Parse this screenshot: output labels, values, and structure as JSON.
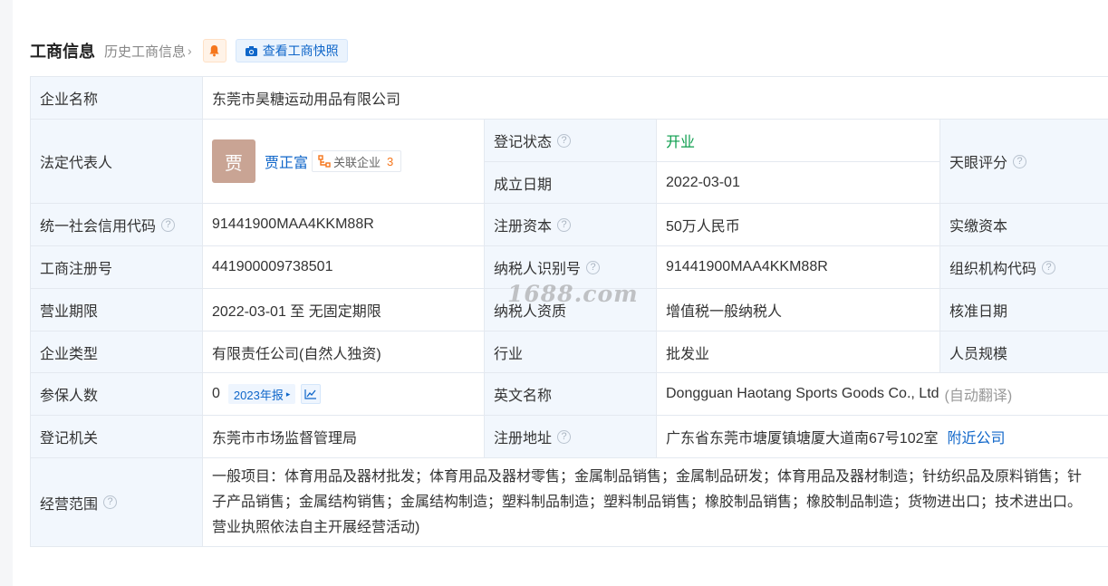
{
  "header": {
    "title": "工商信息",
    "history_link": "历史工商信息",
    "snapshot_label": "查看工商快照"
  },
  "rows": {
    "company_name": {
      "label": "企业名称",
      "value": "东莞市昊糖运动用品有限公司"
    },
    "legal_rep": {
      "label": "法定代表人",
      "avatar_char": "贾",
      "name": "贾正富",
      "related_label": "关联企业",
      "related_count": "3"
    },
    "reg_status": {
      "label": "登记状态",
      "value": "开业"
    },
    "founded": {
      "label": "成立日期",
      "value": "2022-03-01"
    },
    "tianyan_score": {
      "label": "天眼评分"
    },
    "credit_code": {
      "label": "统一社会信用代码",
      "value": "91441900MAA4KKM88R"
    },
    "reg_capital": {
      "label": "注册资本",
      "value": "50万人民币"
    },
    "paid_capital": {
      "label": "实缴资本"
    },
    "reg_number": {
      "label": "工商注册号",
      "value": "441900009738501"
    },
    "taxpayer_id": {
      "label": "纳税人识别号",
      "value": "91441900MAA4KKM88R"
    },
    "org_code": {
      "label": "组织机构代码"
    },
    "term": {
      "label": "营业期限",
      "value": "2022-03-01 至 无固定期限"
    },
    "taxpayer_qual": {
      "label": "纳税人资质",
      "value": "增值税一般纳税人"
    },
    "approval_date": {
      "label": "核准日期"
    },
    "company_type": {
      "label": "企业类型",
      "value": "有限责任公司(自然人独资)"
    },
    "industry": {
      "label": "行业",
      "value": "批发业"
    },
    "staff_size": {
      "label": "人员规模"
    },
    "insured": {
      "label": "参保人数",
      "value": "0",
      "report": "2023年报"
    },
    "english_name": {
      "label": "英文名称",
      "value": "Dongguan Haotang Sports Goods Co., Ltd",
      "translate": "(自动翻译)"
    },
    "reg_authority": {
      "label": "登记机关",
      "value": "东莞市市场监督管理局"
    },
    "reg_address": {
      "label": "注册地址",
      "value": "广东省东莞市塘厦镇塘厦大道南67号102室",
      "nearby": "附近公司"
    },
    "scope": {
      "label": "经营范围",
      "line1": "一般项目：体育用品及器材批发；体育用品及器材零售；金属制品销售；金属制品研发；体育用品及器材制造；针纺织品及原料销售；针",
      "line2": "子产品销售；金属结构销售；金属结构制造；塑料制品制造；塑料制品销售；橡胶制品销售；橡胶制品制造；货物进出口；技术进出口。",
      "line3": "营业执照依法自主开展经营活动)"
    }
  },
  "watermark": "1688.com",
  "colors": {
    "accent": "#0f66c9",
    "label_bg": "#f2f7fd",
    "status_green": "#0b9d4c",
    "count_orange": "#f5761c"
  }
}
